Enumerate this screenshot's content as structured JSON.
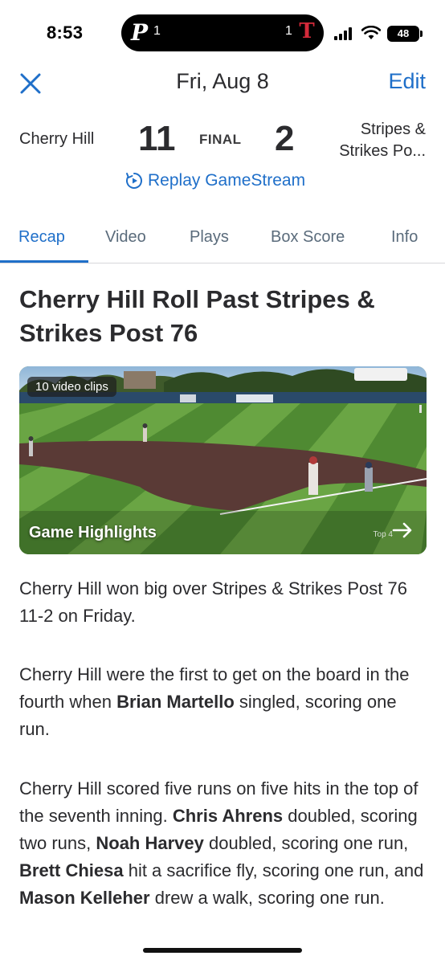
{
  "status_bar": {
    "time": "8:53",
    "island_left_count": "1",
    "island_right_count": "1",
    "island_left_logo": "P",
    "island_right_logo": "T",
    "battery": "48"
  },
  "header": {
    "title": "Fri, Aug 8",
    "edit_label": "Edit"
  },
  "game": {
    "home_team": "Cherry Hill",
    "home_score": "11",
    "status": "FINAL",
    "away_score": "2",
    "away_team_line1": "Stripes &",
    "away_team_line2": "Strikes Po...",
    "replay_label": "Replay GameStream"
  },
  "tabs": [
    {
      "label": "Recap",
      "active": true
    },
    {
      "label": "Video",
      "active": false
    },
    {
      "label": "Plays",
      "active": false
    },
    {
      "label": "Box Score",
      "active": false
    },
    {
      "label": "Info",
      "active": false
    }
  ],
  "article": {
    "headline": "Cherry Hill Roll Past Stripes & Strikes Post 76",
    "video": {
      "clips": "10 video clips",
      "title": "Game Highlights",
      "inning": "Top 4"
    },
    "p1": "Cherry Hill won big over Stripes & Strikes Post 76 11-2 on Friday.",
    "p2": {
      "a": "Cherry Hill were the first to get on the board in the fourth when ",
      "b": "Brian Martello",
      "c": " singled, scoring one run."
    },
    "p3": {
      "a": "Cherry Hill scored five runs on five hits in the top of the seventh inning. ",
      "b": "Chris Ahrens",
      "c": " doubled, scoring two runs, ",
      "d": "Noah Harvey",
      "e": " doubled, scoring one run, ",
      "f": "Brett Chiesa",
      "g": " hit a sacrifice fly, scoring one run, and ",
      "h": "Mason Kelleher",
      "i": " drew a walk, scoring one run."
    }
  },
  "colors": {
    "accent": "#1f6fc9",
    "text": "#2b2b2e",
    "tab_inactive": "#5a6b7b"
  }
}
